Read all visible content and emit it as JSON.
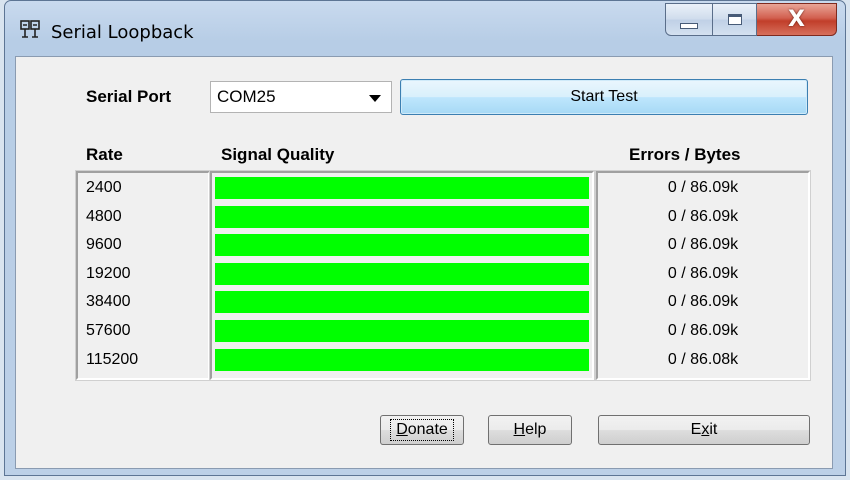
{
  "window": {
    "title": "Serial Loopback",
    "icon": "serial-loopback-icon",
    "caption_icons": [
      "minimize-icon",
      "maximize-icon",
      "close-icon"
    ],
    "close_glyph": "X"
  },
  "port": {
    "label": "Serial Port",
    "selected": "COM25"
  },
  "start_button": {
    "label": "Start Test"
  },
  "columns": {
    "rate": "Rate",
    "quality": "Signal Quality",
    "errors": "Errors / Bytes"
  },
  "rows": [
    {
      "rate": "2400",
      "quality": 1.0,
      "errors": "0 / 86.09k"
    },
    {
      "rate": "4800",
      "quality": 1.0,
      "errors": "0 / 86.09k"
    },
    {
      "rate": "9600",
      "quality": 1.0,
      "errors": "0 / 86.09k"
    },
    {
      "rate": "19200",
      "quality": 1.0,
      "errors": "0 / 86.09k"
    },
    {
      "rate": "38400",
      "quality": 1.0,
      "errors": "0 / 86.09k"
    },
    {
      "rate": "57600",
      "quality": 1.0,
      "errors": "0 / 86.09k"
    },
    {
      "rate": "115200",
      "quality": 1.0,
      "errors": "0 / 86.08k"
    }
  ],
  "bar_color": "#00ff00",
  "bar_track_color": "#ffffff",
  "buttons": {
    "donate": {
      "label": "Donate",
      "mnemonic": "D",
      "rest": "onate"
    },
    "help": {
      "label": "Help",
      "mnemonic": "H",
      "rest": "elp"
    },
    "exit": {
      "label": "Exit",
      "first": "E",
      "mnemonic": "x",
      "rest": "it"
    }
  }
}
